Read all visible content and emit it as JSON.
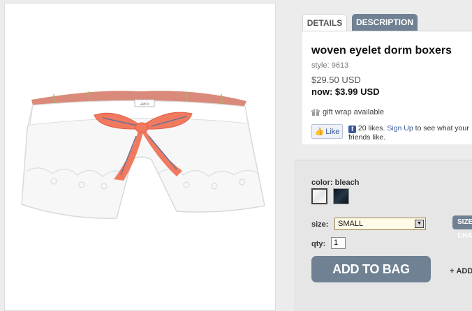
{
  "product": {
    "brand_tag": "aero",
    "tabs": [
      "DETAILS",
      "DESCRIPTION"
    ],
    "name": "woven eyelet dorm boxers",
    "style": "style: 9613",
    "price_original": "$29.50 USD",
    "price_now": "now: $3.99 USD",
    "gift_wrap": "gift wrap available"
  },
  "facebook": {
    "like_label": "Like",
    "likes_text": "20 likes.",
    "signup_link": "Sign Up",
    "signup_suffix": "to see what your friends like."
  },
  "options": {
    "color_label": "color: bleach",
    "swatches": [
      {
        "name": "bleach",
        "color": "#f4f4f4",
        "selected": true
      },
      {
        "name": "navy",
        "color": "#16212c",
        "selected": false
      }
    ],
    "size_label": "size:",
    "size_value": "SMALL",
    "size_chart_label": "SIZE CHART",
    "qty_label": "qty:",
    "qty_value": "1",
    "add_to_bag": "ADD TO BAG",
    "add_wishlist": "ADD TO WISHLIST"
  },
  "colors": {
    "accent": "#6f8193",
    "facebook": "#3b5998",
    "ribbon": "#f07a5f"
  }
}
